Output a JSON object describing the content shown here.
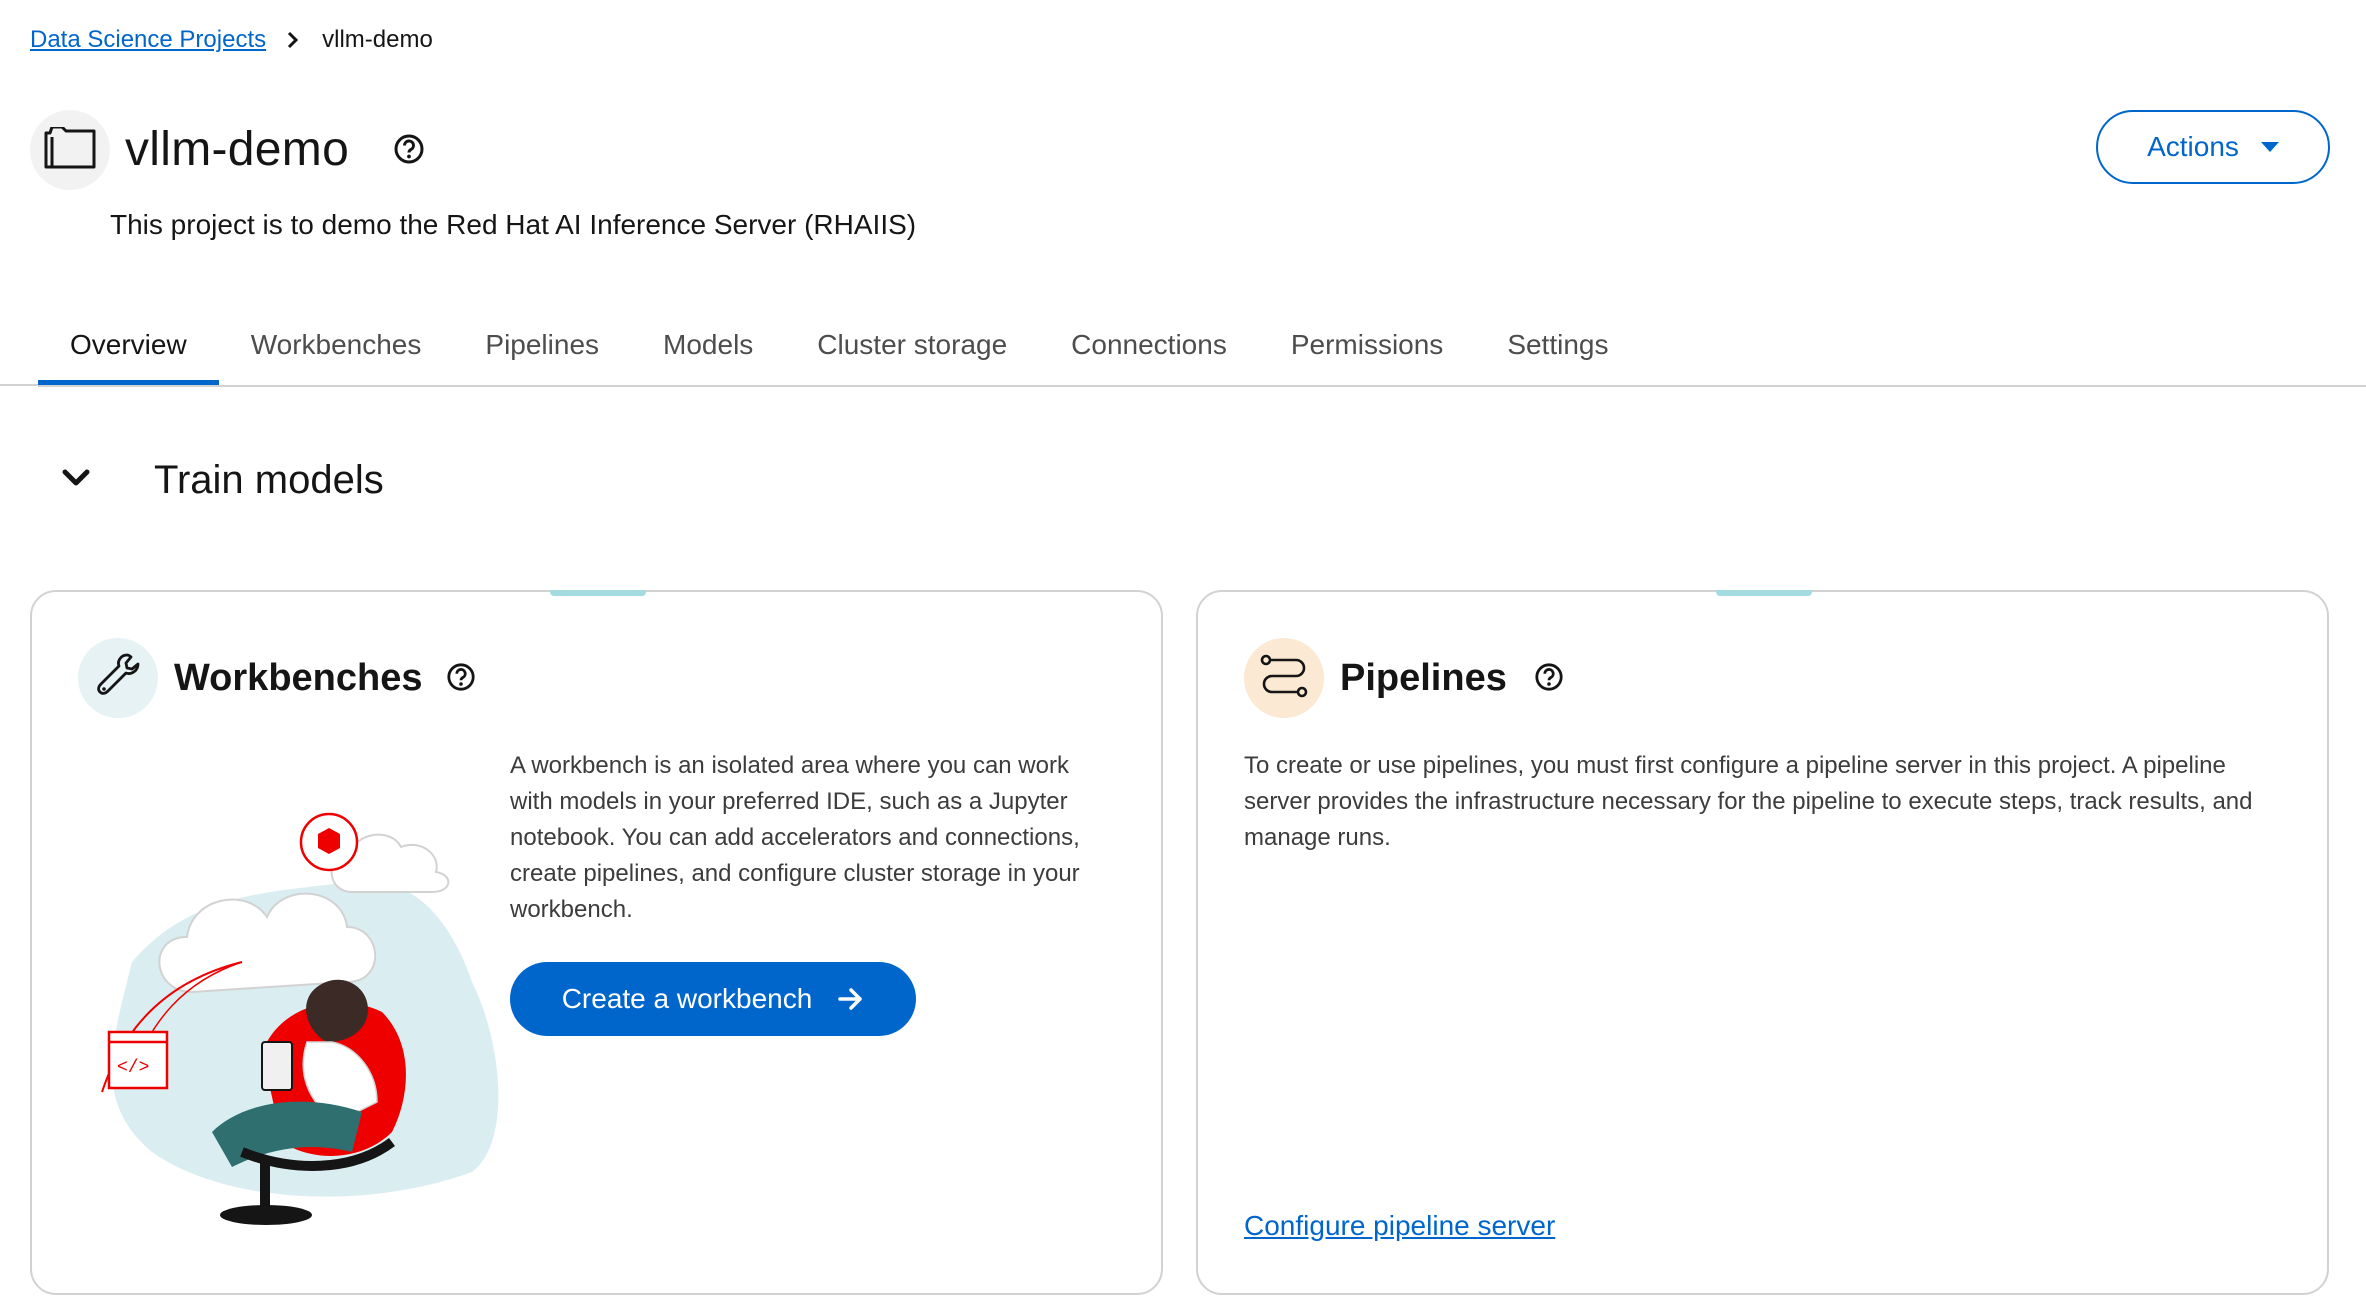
{
  "breadcrumb": {
    "parent": "Data Science Projects",
    "current": "vllm-demo"
  },
  "header": {
    "title": "vllm-demo",
    "description": "This project is to demo the Red Hat AI Inference Server (RHAIIS)",
    "actions_label": "Actions"
  },
  "tabs": [
    {
      "label": "Overview",
      "active": true
    },
    {
      "label": "Workbenches"
    },
    {
      "label": "Pipelines"
    },
    {
      "label": "Models"
    },
    {
      "label": "Cluster storage"
    },
    {
      "label": "Connections"
    },
    {
      "label": "Permissions"
    },
    {
      "label": "Settings"
    }
  ],
  "section": {
    "title": "Train models"
  },
  "workbenches_card": {
    "title": "Workbenches",
    "description": "A workbench is an isolated area where you can work with models in your preferred IDE, such as a Jupyter notebook. You can add accelerators and connections, create pipelines, and configure cluster storage in your workbench.",
    "button_label": "Create a workbench"
  },
  "pipelines_card": {
    "title": "Pipelines",
    "description": "To create or use pipelines, you must first configure a pipeline server in this project. A pipeline server provides the infrastructure necessary for the pipeline to execute steps, track results, and manage runs.",
    "link_label": "Configure pipeline server"
  },
  "colors": {
    "primary": "#0066cc",
    "accent_tick": "#a3dbe0",
    "illustration_red": "#ee0000",
    "illustration_teal": "#daeef1"
  },
  "icons": [
    "chevron-right-icon",
    "folder-icon",
    "help-icon",
    "caret-down-icon",
    "chevron-down-icon",
    "wrench-icon",
    "pipeline-icon",
    "arrow-right-icon"
  ]
}
